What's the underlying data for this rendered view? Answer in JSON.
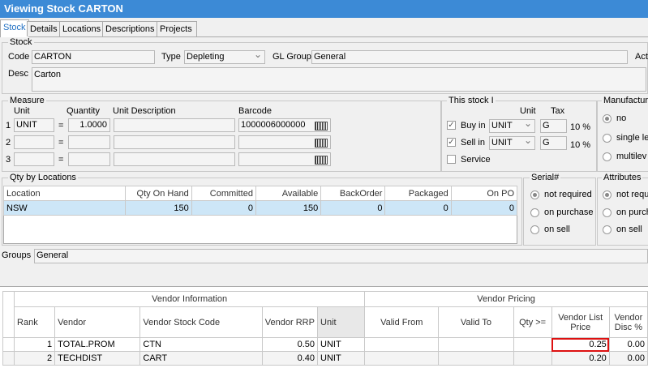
{
  "window": {
    "title": "Viewing Stock CARTON"
  },
  "tabs": [
    "Stock",
    "Details",
    "Locations",
    "Descriptions",
    "Projects"
  ],
  "stock": {
    "section": "Stock",
    "code_label": "Code",
    "code": "CARTON",
    "type_label": "Type",
    "type": "Depleting",
    "gl_group_label": "GL Group",
    "gl_group": "General",
    "active_label": "Act",
    "desc_label": "Desc",
    "desc": "Carton"
  },
  "measure": {
    "section": "Measure",
    "headers": {
      "unit": "Unit",
      "quantity": "Quantity",
      "unit_desc": "Unit Description",
      "barcode": "Barcode"
    },
    "rows": [
      {
        "n": "1",
        "unit": "UNIT",
        "eq": "=",
        "qty": "1.0000",
        "desc": "",
        "barcode": "1000006000000"
      },
      {
        "n": "2",
        "unit": "",
        "eq": "=",
        "qty": "",
        "desc": "",
        "barcode": ""
      },
      {
        "n": "3",
        "unit": "",
        "eq": "=",
        "qty": "",
        "desc": "",
        "barcode": ""
      }
    ]
  },
  "this_stock": {
    "section": "This stock I",
    "unit_header": "Unit",
    "tax_header": "Tax",
    "buy_label": "Buy in",
    "buy_unit": "UNIT",
    "buy_tax": "G",
    "buy_pct": "10 %",
    "sell_label": "Sell in",
    "sell_unit": "UNIT",
    "sell_tax": "G",
    "sell_pct": "10 %",
    "service_label": "Service"
  },
  "manufactured": {
    "section": "Manufactur",
    "options": [
      "no",
      "single le",
      "multilev"
    ]
  },
  "qty_locations": {
    "section": "Qty by Locations",
    "columns": [
      "Location",
      "Qty On Hand",
      "Committed",
      "Available",
      "BackOrder",
      "Packaged",
      "On PO"
    ],
    "rows": [
      [
        "NSW",
        "150",
        "0",
        "150",
        "0",
        "0",
        "0"
      ]
    ]
  },
  "serial": {
    "section": "Serial#",
    "options": [
      "not required",
      "on purchase",
      "on sell"
    ]
  },
  "attributes": {
    "section": "Attributes",
    "options": [
      "not requ",
      "on purch",
      "on sell"
    ]
  },
  "groups": {
    "label": "Groups",
    "value": "General"
  },
  "vendor": {
    "info_header": "Vendor Information",
    "pricing_header": "Vendor Pricing",
    "columns": [
      "Rank",
      "Vendor",
      "Vendor Stock Code",
      "Vendor RRP",
      "Unit",
      "Valid From",
      "Valid To",
      "Qty >=",
      "Vendor List Price",
      "Vendor Disc %"
    ],
    "rows": [
      [
        "1",
        "TOTAL.PROM",
        "CTN",
        "0.50",
        "UNIT",
        "",
        "",
        "",
        "0.25",
        "0.00"
      ],
      [
        "2",
        "TECHDIST",
        "CART",
        "0.40",
        "UNIT",
        "",
        "",
        "",
        "0.20",
        "0.00"
      ]
    ]
  }
}
